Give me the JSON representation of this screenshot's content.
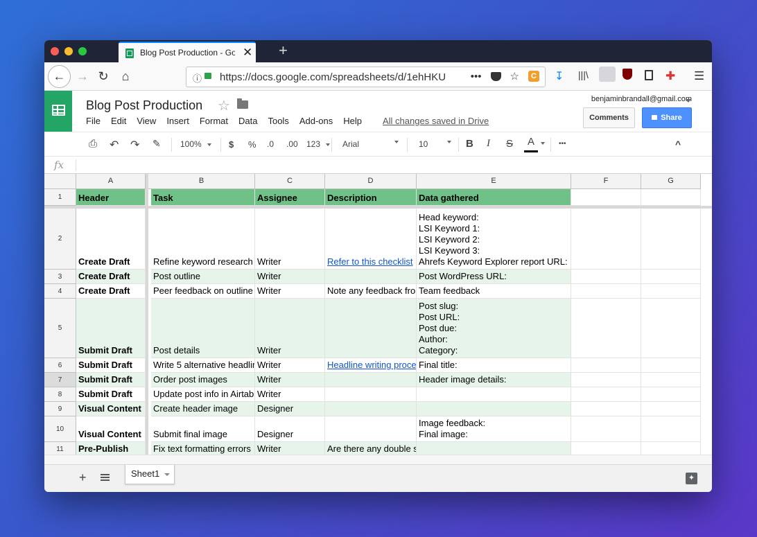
{
  "browser": {
    "tab_title": "Blog Post Production - Google Sheets",
    "tab_close": "✕",
    "new_tab": "+",
    "url_main": "https://docs.google.com/spreadsheets/d/1ehHKU",
    "url_icons": [
      "info-icon",
      "lock-icon",
      "more-icon",
      "pocket-icon",
      "bookmark-star-icon"
    ],
    "extensions": [
      "download-icon",
      "library-icon",
      "reader-view-icon",
      "ublock-icon",
      "notes-icon",
      "extension-icon",
      "menu-icon"
    ]
  },
  "app": {
    "title": "Blog Post Production",
    "menus": [
      "File",
      "Edit",
      "View",
      "Insert",
      "Format",
      "Data",
      "Tools",
      "Add-ons",
      "Help"
    ],
    "saved_status": "All changes saved in Drive",
    "account": "benjaminbrandall@gmail.com",
    "comments_label": "Comments",
    "share_label": "Share"
  },
  "toolbar": {
    "zoom": "100%",
    "currency": "$",
    "percent": "%",
    "dec_decrease": ".0",
    "dec_increase": ".00",
    "more_formats": "123",
    "font": "Arial",
    "font_size": "10",
    "bold": "B",
    "italic": "I",
    "strike": "S",
    "text_color": "A",
    "more": "•••",
    "collapse": "^"
  },
  "formula": {
    "fx": "fx"
  },
  "columns": [
    "A",
    "B",
    "C",
    "D",
    "E",
    "F",
    "G"
  ],
  "rows": [
    {
      "num": "1",
      "style": "header",
      "cells": [
        "Header",
        "Task",
        "Assignee",
        "Description",
        "Data gathered",
        "",
        ""
      ]
    },
    {
      "num": "2",
      "style": "white",
      "cells": [
        "Create Draft",
        "Refine keyword research",
        "Writer",
        "Refer to this checklist",
        "Head keyword:\nLSI Keyword 1:\nLSI Keyword 2:\nLSI Keyword 3:\nAhrefs Keyword Explorer report URL:",
        "",
        ""
      ]
    },
    {
      "num": "3",
      "style": "green",
      "cells": [
        "Create Draft",
        "Post outline",
        "Writer",
        "",
        "Post WordPress URL:",
        "",
        ""
      ]
    },
    {
      "num": "4",
      "style": "white",
      "cells": [
        "Create Draft",
        "Peer feedback on outline",
        "Writer",
        "Note any feedback fro",
        "Team feedback",
        "",
        ""
      ]
    },
    {
      "num": "5",
      "style": "green",
      "cells": [
        "Submit Draft",
        "Post details",
        "Writer",
        "",
        "Post slug:\nPost URL:\nPost due:\nAuthor:\nCategory:",
        "",
        ""
      ]
    },
    {
      "num": "6",
      "style": "white",
      "cells": [
        "Submit Draft",
        "Write 5 alternative headlin",
        "Writer",
        "Headline writing proce",
        "Final title:",
        "",
        ""
      ]
    },
    {
      "num": "7",
      "style": "green",
      "cells": [
        "Submit Draft",
        "Order post images",
        "Writer",
        "",
        "Header image details:",
        "",
        ""
      ]
    },
    {
      "num": "8",
      "style": "white",
      "cells": [
        "Submit Draft",
        "Update post info in Airtabl",
        "Writer",
        "",
        "",
        "",
        ""
      ]
    },
    {
      "num": "9",
      "style": "green",
      "cells": [
        "Visual Content",
        "Create header image",
        "Designer",
        "",
        "",
        "",
        ""
      ]
    },
    {
      "num": "10",
      "style": "white",
      "cells": [
        "Visual Content",
        "Submit final image",
        "Designer",
        "",
        "Image feedback:\nFinal image:",
        "",
        ""
      ]
    },
    {
      "num": "11",
      "style": "green",
      "cells": [
        "Pre-Publish",
        "Fix text formatting errors",
        "Writer",
        "Are there any double s",
        "",
        "",
        ""
      ]
    }
  ],
  "sheet": {
    "add": "+",
    "tab": "Sheet1"
  }
}
